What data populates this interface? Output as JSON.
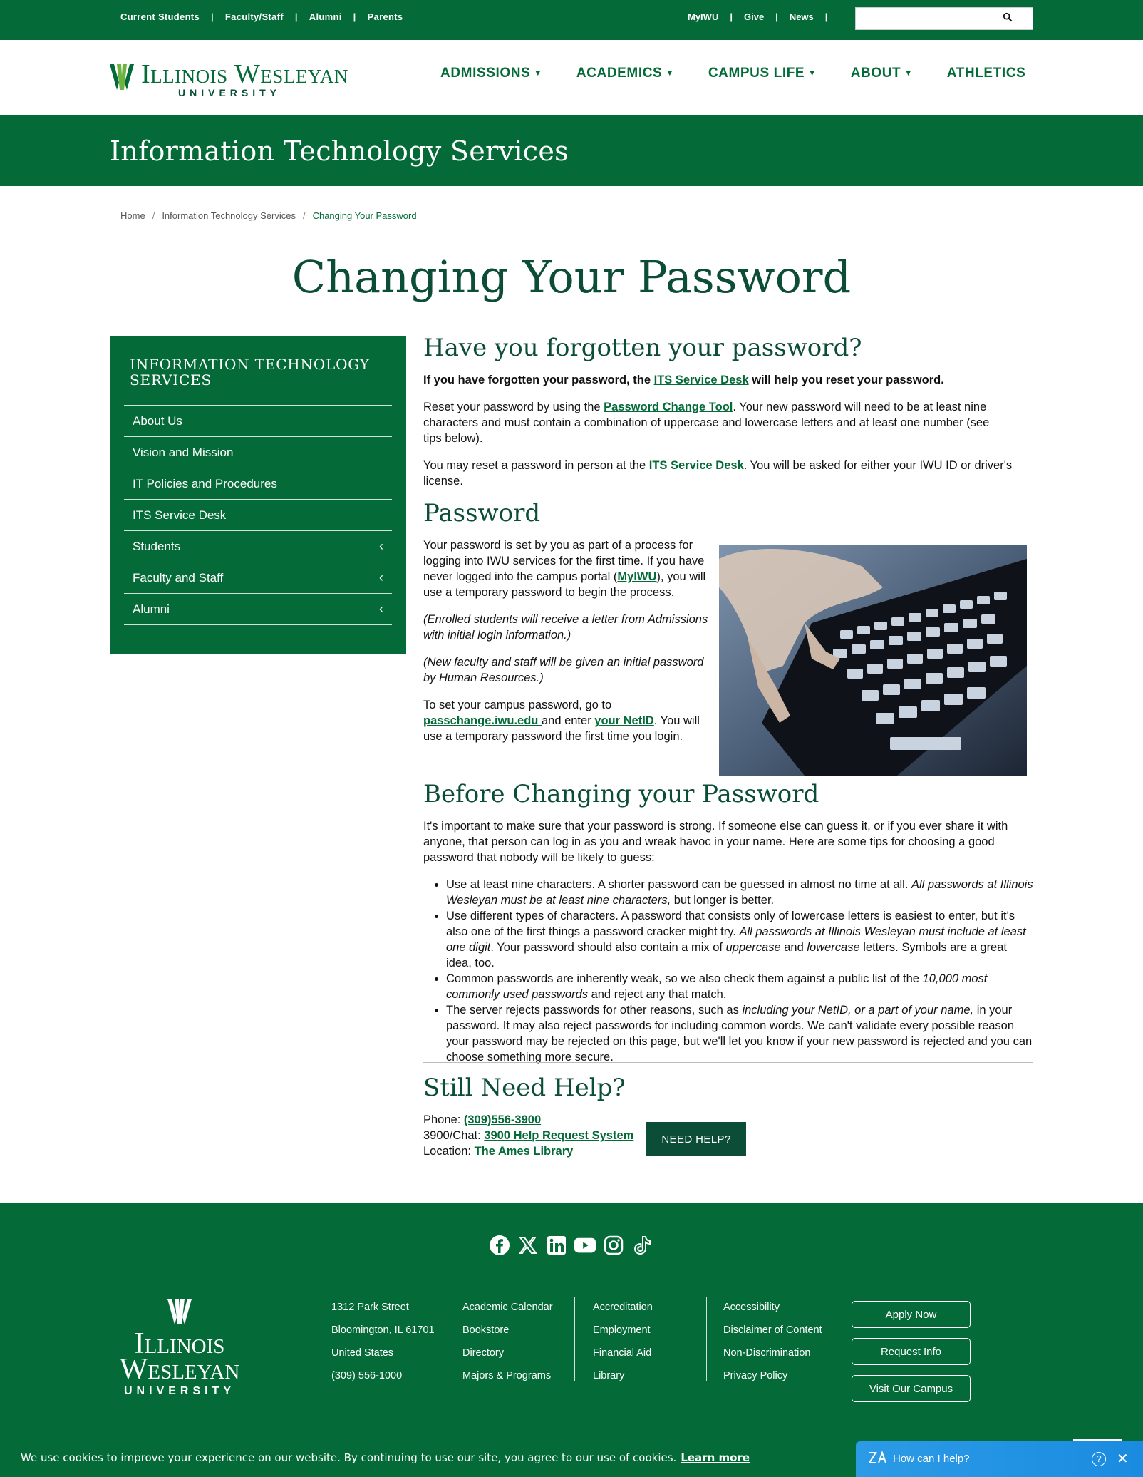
{
  "utility": {
    "left_links": [
      "Current Students",
      "Faculty/Staff",
      "Alumni",
      "Parents"
    ],
    "right_links": [
      "MyIWU",
      "Give",
      "News"
    ],
    "separator": "|",
    "search_placeholder": ""
  },
  "header": {
    "logo_name": "Illinois Wesleyan",
    "logo_sub": "UNIVERSITY",
    "nav": [
      "ADMISSIONS",
      "ACADEMICS",
      "CAMPUS LIFE",
      "ABOUT",
      "ATHLETICS"
    ]
  },
  "banner": {
    "title": "Information Technology Services"
  },
  "breadcrumb": {
    "items": [
      "Home",
      "Information Technology Services"
    ],
    "current": "Changing Your Password",
    "separator": "/"
  },
  "page_title": "Changing Your Password",
  "sidebar": {
    "title": "Information Technology Services",
    "items": [
      {
        "label": "About Us",
        "chevron": ""
      },
      {
        "label": "Vision and Mission",
        "chevron": ""
      },
      {
        "label": "IT Policies and Procedures",
        "chevron": ""
      },
      {
        "label": "ITS Service Desk",
        "chevron": ""
      },
      {
        "label": "Students",
        "chevron": "‹"
      },
      {
        "label": "Faculty and Staff",
        "chevron": "‹"
      },
      {
        "label": "Alumni",
        "chevron": "‹"
      }
    ]
  },
  "sec1": {
    "heading": "Have you forgotten your password?",
    "p1_a": "If you have forgotten your password, the ",
    "p1_link": "ITS Service Desk",
    "p1_b": " will help you reset your password.",
    "p2_a": "Reset your password by using the ",
    "p2_link": "Password Change Tool",
    "p2_b": ". Your new password will need to be at least nine characters and must contain a combination of uppercase and lowercase letters and at least one number (see tips below).",
    "p3_a": "You may reset a password in person at the ",
    "p3_link": "ITS Service Desk",
    "p3_b": ". You will be asked for either your IWU ID or driver's license."
  },
  "sec2": {
    "heading": "Password",
    "p1_a": "Your password is set by you as part of a process for logging into IWU services for the first time. If you have never logged into the campus portal (",
    "p1_link": "MyIWU",
    "p1_b": "), you will use a temporary password to begin the process.",
    "p2": "(Enrolled students will receive a letter from Admissions with initial login information.)",
    "p3": "(New faculty and staff will be given an initial password by Human Resources.)",
    "p4_a": "To set your campus password, go to ",
    "p4_link1": "passchange.iwu.edu ",
    "p4_b": "and enter ",
    "p4_link2": "your NetID",
    "p4_c": ". You will use a temporary password the first time you login."
  },
  "sec3": {
    "heading": "Before Changing your Password",
    "intro": "It's important to make sure that your password is strong. If someone else can guess it, or if you ever share it with anyone, that person can log in as you and wreak havoc in your name. Here are some tips for choosing a good password that nobody will be likely to guess:",
    "tip1_a": "Use at least nine characters. A shorter password can be guessed in almost no time at all. ",
    "tip1_i": "All passwords at Illinois Wesleyan must be at least nine characters,",
    "tip1_b": " but longer is better.",
    "tip2_a": "Use different types of characters. A password that consists only of lowercase letters is easiest to enter, but it's also one of the first things a password cracker might try. ",
    "tip2_i": "All passwords at Illinois Wesleyan must include at least one digit",
    "tip2_b": ". Your password should also contain a mix of ",
    "tip2_i2": "uppercase",
    "tip2_c": " and ",
    "tip2_i3": "lowercase",
    "tip2_d": " letters. Symbols are a great idea, too.",
    "tip3_a": "Common passwords are inherently weak, so we also check them against a public list of the ",
    "tip3_i": "10,000 most commonly used passwords",
    "tip3_b": " and reject any that match.",
    "tip4_a": "The server rejects passwords for other reasons, such as ",
    "tip4_i": "including your NetID, or a part of your name,",
    "tip4_b": " in your password. It may also reject passwords for including common words. We can't validate every possible reason your password may be rejected on this page, but we'll let you know if your new password is rejected and you can choose something more secure."
  },
  "sec4": {
    "heading": "Still Need Help?",
    "phone_label": "Phone: ",
    "phone": "(309)556-3900",
    "chat_label": "3900/Chat: ",
    "chat": "3900 Help Request System",
    "location_label": "Location: ",
    "location": "The Ames Library",
    "button": "NEED HELP?"
  },
  "footer": {
    "social": [
      "facebook-icon",
      "x-icon",
      "linkedin-icon",
      "youtube-icon",
      "instagram-icon",
      "tiktok-icon"
    ],
    "logo_name_1": "Illinois",
    "logo_name_2": "Wesleyan",
    "logo_sub": "UNIVERSITY",
    "address": [
      "1312 Park Street",
      "Bloomington, IL 61701",
      "United States",
      "(309) 556-1000"
    ],
    "col2": [
      "Academic Calendar",
      "Bookstore",
      "Directory",
      "Majors & Programs"
    ],
    "col3": [
      "Accreditation",
      "Employment",
      "Financial Aid",
      "Library"
    ],
    "col4": [
      "Accessibility",
      "Disclaimer of Content",
      "Non-Discrimination",
      "Privacy Policy"
    ],
    "buttons": [
      "Apply Now",
      "Request Info",
      "Visit Our Campus"
    ]
  },
  "cookie": {
    "text": "We use cookies to improve your experience on our website. By continuing to use our site, you agree to our use of cookies.",
    "learn_more": "Learn more"
  },
  "chat": {
    "label": "How can I help?",
    "help": "?",
    "close": "✕"
  },
  "colors": {
    "brand_green": "#046a38",
    "dark_green": "#0b4d36",
    "chat_blue": "#2c9be6"
  }
}
